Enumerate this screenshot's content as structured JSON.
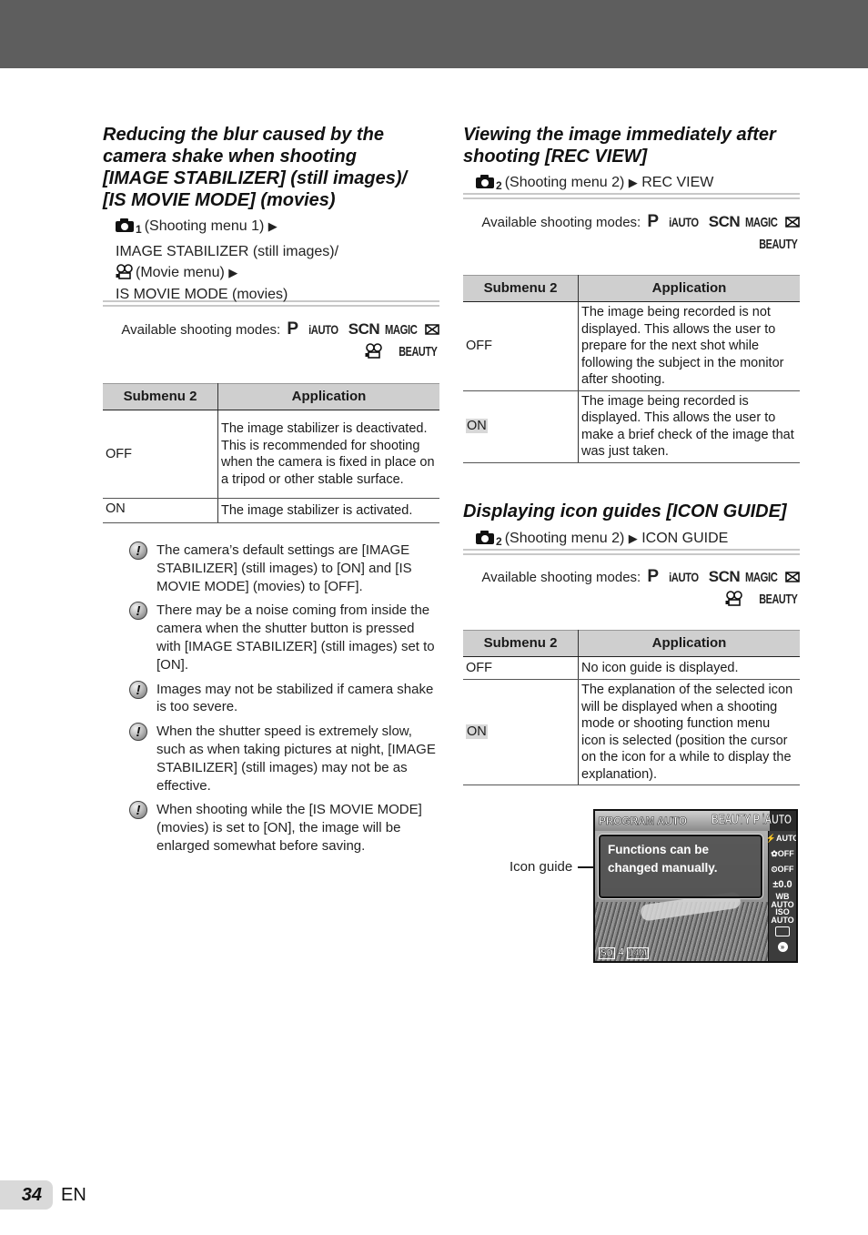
{
  "page": {
    "number": "34",
    "language": "EN"
  },
  "left": {
    "title": "Reducing the blur caused by the camera shake when shooting [IMAGE STABILIZER] (still images)/ [IS MOVIE MODE] (movies)",
    "title_lines": [
      "Reducing the blur caused by the",
      "camera shake when shooting",
      "[IMAGE STABILIZER] (still images)/",
      "[IS MOVIE MODE] (movies)"
    ],
    "menu_path": {
      "camera_sub": "1",
      "line1": "(Shooting menu 1)",
      "line2": "IMAGE STABILIZER (still images)/",
      "line3": "(Movie menu)",
      "line4": "IS MOVIE MODE (movies)",
      "arrow": "▶"
    },
    "modes": {
      "label": "Available shooting modes:",
      "items": [
        "P",
        "iAUTO",
        "SCN",
        "MAGIC",
        "panorama",
        "movie",
        "BEAUTY"
      ]
    },
    "table": {
      "headers": [
        "Submenu 2",
        "Application"
      ],
      "rows": [
        {
          "key": "OFF",
          "value": "The image stabilizer is deactivated. This is recommended for shooting when the camera is fixed in place on a tripod or other stable surface."
        },
        {
          "key": "ON",
          "value": "The image stabilizer is activated."
        }
      ]
    },
    "notes": [
      "The camera’s default settings are [IMAGE STABILIZER] (still images) to [ON] and [IS MOVIE MODE] (movies) to [OFF].",
      "There may be a noise coming from inside the camera when the shutter button is pressed with [IMAGE STABILIZER] (still images) set to [ON].",
      "Images may not be stabilized if camera shake is too severe.",
      "When the shutter speed is extremely slow, such as when taking pictures at night, [IMAGE STABILIZER] (still images) may not be as effective.",
      "When shooting while the [IS MOVIE MODE] (movies) is set to [ON], the image will be enlarged somewhat before saving."
    ],
    "note_icon": "!"
  },
  "right": {
    "rec_view": {
      "title_lines": [
        "Viewing the image immediately after",
        "shooting [REC VIEW]"
      ],
      "menu_path": {
        "camera_sub": "2",
        "text": "(Shooting menu 2)",
        "arrow": "▶",
        "item": "REC VIEW"
      },
      "modes": {
        "label": "Available shooting modes:",
        "items": [
          "P",
          "iAUTO",
          "SCN",
          "MAGIC",
          "panorama",
          "BEAUTY"
        ]
      },
      "table": {
        "headers": [
          "Submenu 2",
          "Application"
        ],
        "rows": [
          {
            "key": "OFF",
            "value": "The image being recorded is not displayed. This allows the user to prepare for the next shot while following the subject in the monitor after shooting."
          },
          {
            "key": "ON",
            "value": "The image being recorded is displayed. This allows the user to make a brief check of the image that was just taken."
          }
        ]
      }
    },
    "icon_guide": {
      "title": "Displaying icon guides [ICON GUIDE]",
      "menu_path": {
        "camera_sub": "2",
        "text": "(Shooting menu 2)",
        "arrow": "▶",
        "item": "ICON GUIDE"
      },
      "modes": {
        "label": "Available shooting modes:",
        "items": [
          "P",
          "iAUTO",
          "SCN",
          "MAGIC",
          "panorama",
          "movie",
          "BEAUTY"
        ]
      },
      "table": {
        "headers": [
          "Submenu 2",
          "Application"
        ],
        "rows": [
          {
            "key": "OFF",
            "value": "No icon guide is displayed."
          },
          {
            "key": "ON",
            "value": "The explanation of the selected icon will be displayed when a shooting mode or shooting function menu icon is selected (position the cursor on the icon for a while to display the explanation)."
          }
        ]
      },
      "screen": {
        "callout_label": "Icon guide",
        "mode_name": "PROGRAM AUTO",
        "mode_icons": "BEAUTY P iAUTO",
        "guide_text": "Functions can be changed manually.",
        "side_items": [
          "⚡AUTO",
          "✿OFF",
          "⏲OFF",
          "±0.0",
          "WB AUTO",
          "ISO AUTO",
          "▭",
          "»"
        ],
        "bottom": {
          "card": "SD",
          "shots": "4",
          "size": "14M"
        }
      }
    }
  }
}
